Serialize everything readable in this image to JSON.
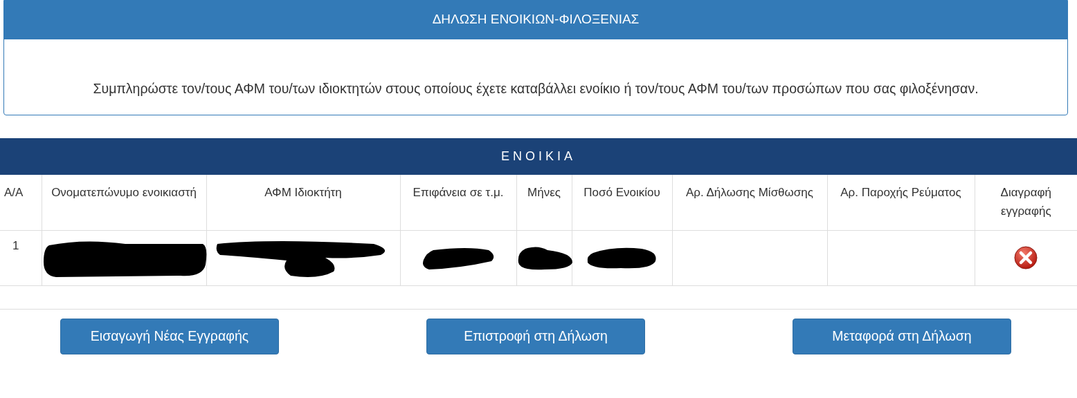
{
  "panel": {
    "title": "ΔΗΛΩΣΗ ΕΝΟΙΚΙΩΝ-ΦΙΛΟΞΕΝΙΑΣ",
    "instruction": "Συμπληρώστε τον/τους ΑΦΜ του/των ιδιοκτητών στους οποίους έχετε καταβάλλει ενοίκιο ή τον/τους ΑΦΜ του/των προσώπων που σας φιλοξένησαν."
  },
  "table": {
    "title": "ΕΝΟΙΚΙΑ",
    "columns": [
      "Α/Α",
      "Ονοματεπώνυμο ενοικιαστή",
      "ΑΦΜ Ιδιοκτήτη",
      "Επιφάνεια σε τ.μ.",
      "Μήνες",
      "Ποσό Ενοικίου",
      "Αρ. Δήλωσης Μίσθωσης",
      "Αρ. Παροχής Ρεύματος",
      "Διαγραφή εγγραφής"
    ],
    "rows": [
      {
        "cells": [
          {
            "kind": "text",
            "text": "1"
          },
          {
            "kind": "redacted"
          },
          {
            "kind": "redacted"
          },
          {
            "kind": "redacted"
          },
          {
            "kind": "redacted"
          },
          {
            "kind": "redacted"
          },
          {
            "kind": "empty"
          },
          {
            "kind": "empty"
          },
          {
            "kind": "delete"
          }
        ]
      }
    ]
  },
  "buttons": [
    "Εισαγωγή Νέας Εγγραφής",
    "Επιστροφή στη Δήλωση",
    "Μεταφορά στη Δήλωση"
  ]
}
